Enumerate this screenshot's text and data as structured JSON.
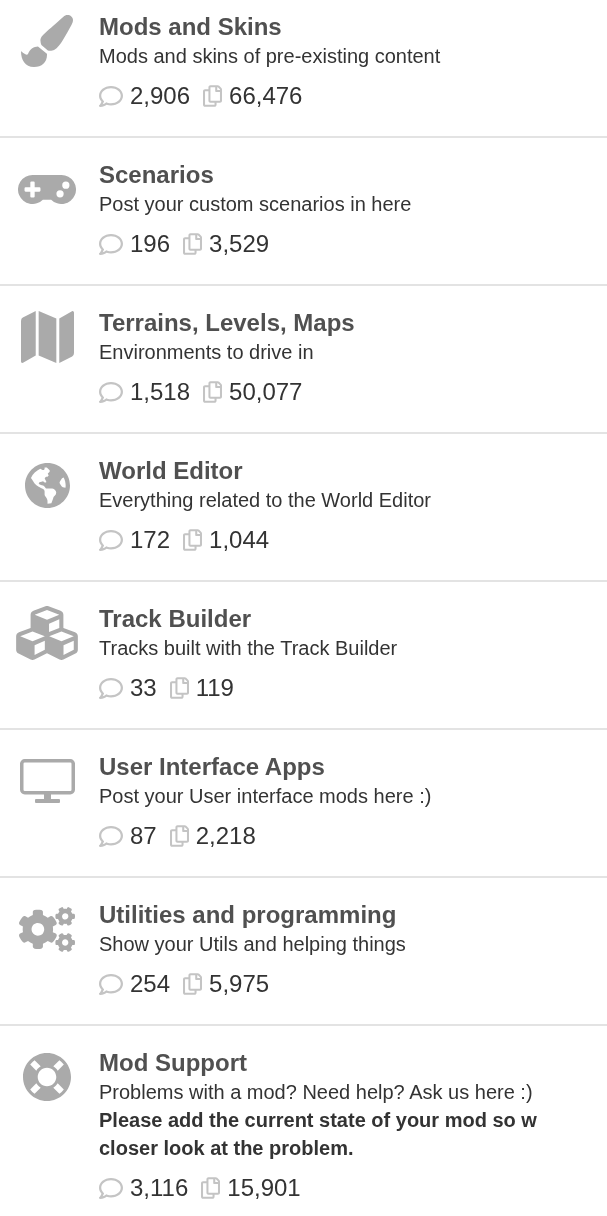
{
  "forums": [
    {
      "title": "Mods and Skins",
      "description": "Mods and skins of pre-existing content",
      "threads": "2,906",
      "posts": "66,476"
    },
    {
      "title": "Scenarios",
      "description": "Post your custom scenarios in here",
      "threads": "196",
      "posts": "3,529"
    },
    {
      "title": "Terrains, Levels, Maps",
      "description": "Environments to drive in",
      "threads": "1,518",
      "posts": "50,077"
    },
    {
      "title": "World Editor",
      "description": "Everything related to the World Editor",
      "threads": "172",
      "posts": "1,044"
    },
    {
      "title": "Track Builder",
      "description": "Tracks built with the Track Builder",
      "threads": "33",
      "posts": "119"
    },
    {
      "title": "User Interface Apps",
      "description": "Post your User interface mods here :)",
      "threads": "87",
      "posts": "2,218"
    },
    {
      "title": "Utilities and programming",
      "description": "Show your Utils and helping things",
      "threads": "254",
      "posts": "5,975"
    },
    {
      "title": "Mod Support",
      "description": "Problems with a mod? Need help? Ask us here :)",
      "note_lines": [
        "Please add the current state of your mod so w",
        "closer look at the problem."
      ],
      "threads": "3,116",
      "posts": "15,901"
    }
  ]
}
